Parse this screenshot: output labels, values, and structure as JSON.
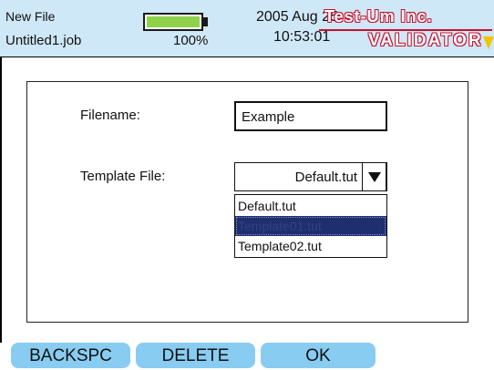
{
  "header": {
    "window_title": "New File",
    "job_name": "Untitled1.job",
    "battery_percent_label": "100%",
    "battery_level": 1.0,
    "date": "2005 Aug 25",
    "time": "10:53:01",
    "brand_company": "Test-Um Inc.",
    "brand_product": "VALIDATOR",
    "colors": {
      "header_bg": "#cfe8f7",
      "battery_fill": "#8fd14a",
      "brand_red": "#c8102e"
    }
  },
  "form": {
    "filename_label": "Filename:",
    "filename_value": "Example",
    "template_label": "Template File:",
    "template_value": "Default.tut",
    "dropdown_icon": "triangle-down-icon",
    "options": [
      {
        "label": "Default.tut",
        "selected": false
      },
      {
        "label": "Template01.tut",
        "selected": true
      },
      {
        "label": "Template02.tut",
        "selected": false
      }
    ],
    "colors": {
      "selected_bg": "#1f2e6e"
    }
  },
  "softkeys": {
    "backspace": "BACKSPC",
    "delete": "DELETE",
    "ok": "OK",
    "color": "#88ccf2"
  }
}
